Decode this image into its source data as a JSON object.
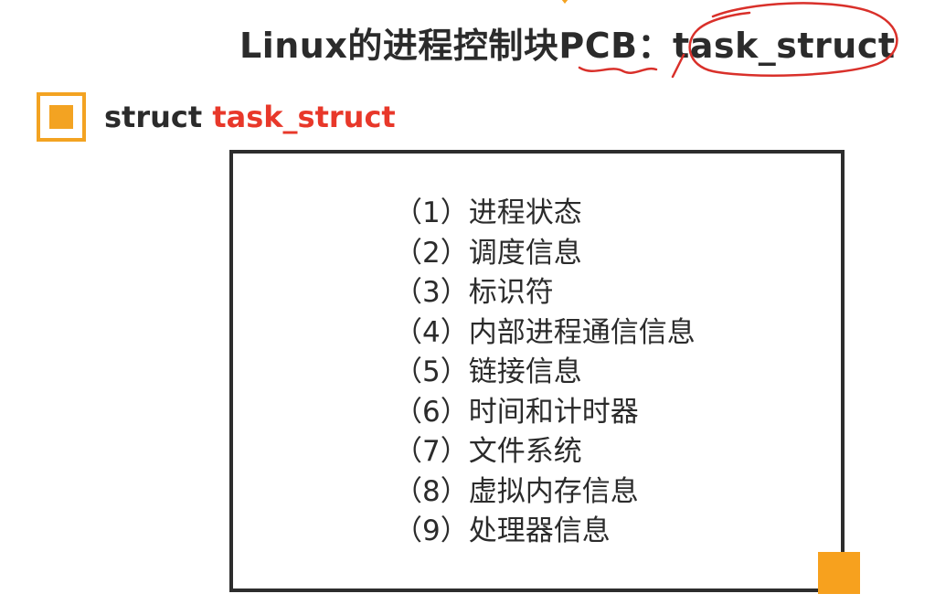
{
  "slide": {
    "title": "Linux的进程控制块PCB：task_struct",
    "subtitle_keyword": "struct ",
    "subtitle_name": "task_struct",
    "items": [
      "（1）进程状态",
      "（2）调度信息",
      "（3）标识符",
      "（4）内部进程通信信息",
      "（5）链接信息",
      "（6）时间和计时器",
      "（7）文件系统",
      "（8）虚拟内存信息",
      "（9）处理器信息"
    ]
  },
  "colors": {
    "accent_orange": "#f3a322",
    "highlight_red": "#e8382a",
    "text_dark": "#2b2b2b",
    "pen_red": "#d9302a"
  },
  "icons": {
    "bullet": "orange-square-bullet-icon",
    "corner": "orange-corner-square"
  }
}
